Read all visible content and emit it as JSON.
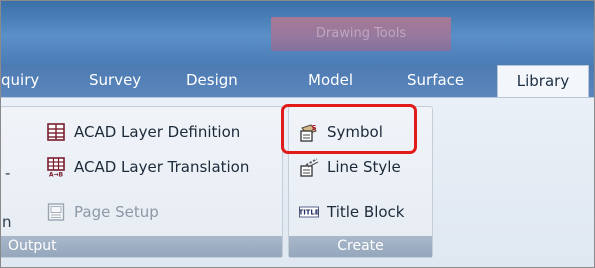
{
  "title_bar": {
    "contextual_tab_title": "Drawing Tools"
  },
  "tabs": [
    {
      "label": "quiry",
      "active": false
    },
    {
      "label": "Survey",
      "active": false
    },
    {
      "label": "Design",
      "active": false
    },
    {
      "label": "Model",
      "active": false
    },
    {
      "label": "Surface",
      "active": false
    },
    {
      "label": "Library",
      "active": true
    }
  ],
  "groups": {
    "output": {
      "label": "Output",
      "fragments": {
        "dash": "-",
        "n": "n"
      },
      "items": [
        {
          "label": "ACAD Layer Definition",
          "icon": "layer-definition-icon",
          "enabled": true
        },
        {
          "label": "ACAD Layer Translation",
          "icon": "layer-translation-icon",
          "enabled": true
        },
        {
          "label": "Page Setup",
          "icon": "page-setup-icon",
          "enabled": false
        }
      ]
    },
    "create": {
      "label": "Create",
      "items": [
        {
          "label": "Symbol",
          "icon": "symbol-icon",
          "highlighted": true
        },
        {
          "label": "Line Style",
          "icon": "line-style-icon"
        },
        {
          "label": "Title Block",
          "icon": "title-block-icon",
          "icon_text": "TITLE"
        }
      ]
    }
  },
  "colors": {
    "highlight": "#e11a1a",
    "tab_bar": "#5b87bd",
    "group_label": "#9aabc0"
  }
}
